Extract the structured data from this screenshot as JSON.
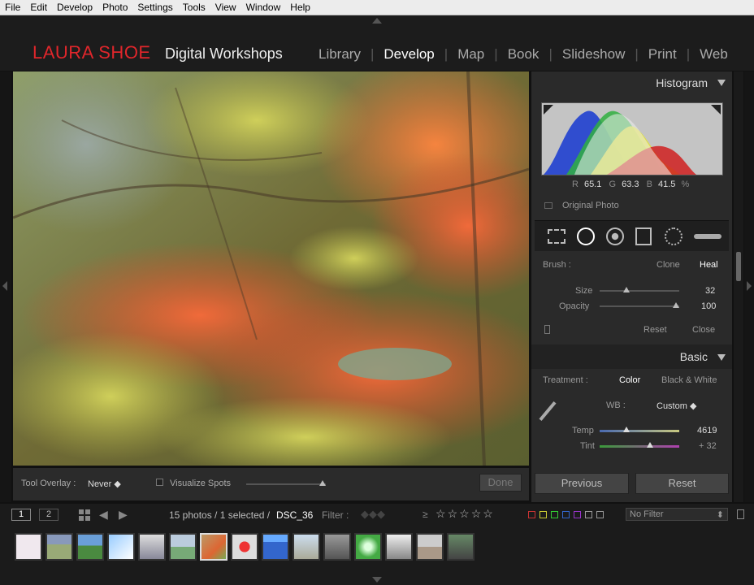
{
  "menu": [
    "File",
    "Edit",
    "Develop",
    "Photo",
    "Settings",
    "Tools",
    "View",
    "Window",
    "Help"
  ],
  "brand": {
    "name": "LAURA SHOE",
    "subtitle": "Digital Workshops"
  },
  "modules": [
    "Library",
    "Develop",
    "Map",
    "Book",
    "Slideshow",
    "Print",
    "Web"
  ],
  "active_module": "Develop",
  "toolbar": {
    "overlay_label": "Tool Overlay :",
    "overlay_value": "Never",
    "visualize_label": "Visualize Spots",
    "done_label": "Done"
  },
  "histogram": {
    "title": "Histogram",
    "r_label": "R",
    "r_value": "65.1",
    "g_label": "G",
    "g_value": "63.3",
    "b_label": "B",
    "b_value": "41.5",
    "unit": "%",
    "original_photo_label": "Original Photo"
  },
  "spot_tool": {
    "brush_label": "Brush :",
    "clone_label": "Clone",
    "heal_label": "Heal",
    "size_label": "Size",
    "size_value": "32",
    "opacity_label": "Opacity",
    "opacity_value": "100",
    "reset_label": "Reset",
    "close_label": "Close"
  },
  "basic": {
    "title": "Basic",
    "treatment_label": "Treatment :",
    "color_label": "Color",
    "bw_label": "Black & White",
    "wb_label": "WB :",
    "wb_value": "Custom",
    "temp_label": "Temp",
    "temp_value": "4619",
    "tint_label": "Tint",
    "tint_value": "+ 32"
  },
  "panel_buttons": {
    "previous": "Previous",
    "reset": "Reset"
  },
  "filmbar": {
    "page1": "1",
    "page2": "2",
    "count_text": "15 photos / 1 selected /",
    "filename": "DSC_36",
    "filter_label": "Filter :",
    "filter_ge": "≥",
    "no_filter": "No Filter"
  }
}
